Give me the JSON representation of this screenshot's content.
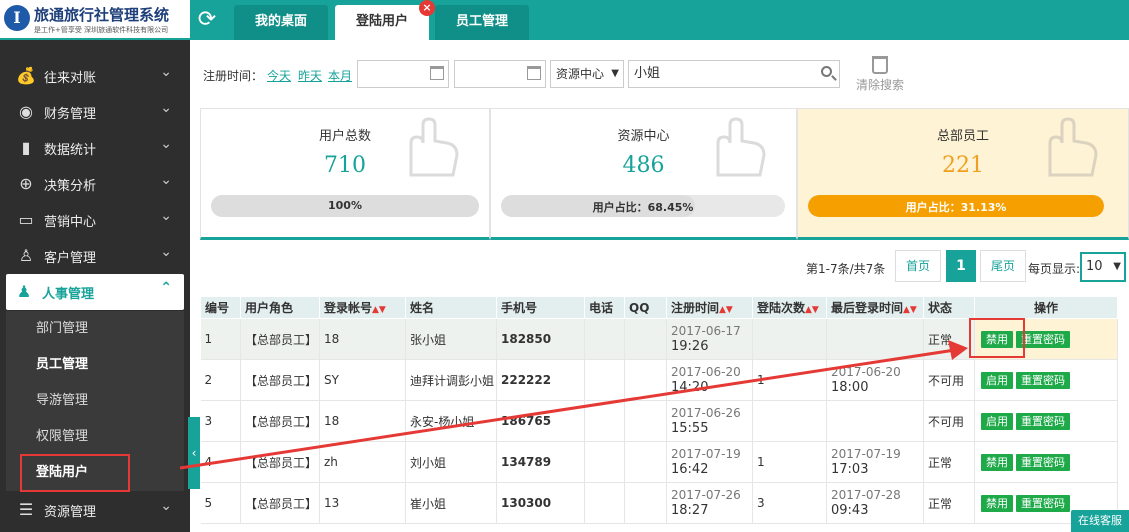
{
  "app": {
    "logo_letter": "I",
    "title": "旅通旅行社管理系统",
    "subtitle": "是工作+管享受  深圳旅通软件科技有限公司"
  },
  "tabs": [
    {
      "label": "我的桌面",
      "active": false
    },
    {
      "label": "登陆用户",
      "active": true,
      "closable": true
    },
    {
      "label": "员工管理",
      "active": false
    }
  ],
  "sidebar": {
    "items": [
      {
        "label": "往来对账",
        "icon": "money-bag-icon"
      },
      {
        "label": "财务管理",
        "icon": "coins-icon"
      },
      {
        "label": "数据统计",
        "icon": "bar-chart-icon"
      },
      {
        "label": "决策分析",
        "icon": "globe-icon"
      },
      {
        "label": "营销中心",
        "icon": "monitor-icon"
      },
      {
        "label": "客户管理",
        "icon": "user-plus-icon"
      },
      {
        "label": "人事管理",
        "icon": "user-icon",
        "open": true
      },
      {
        "label": "资源管理",
        "icon": "list-icon"
      }
    ],
    "subitems": [
      {
        "label": "部门管理",
        "bold": false
      },
      {
        "label": "员工管理",
        "bold": true
      },
      {
        "label": "导游管理",
        "bold": false
      },
      {
        "label": "权限管理",
        "bold": false
      },
      {
        "label": "登陆用户",
        "bold": true,
        "selected": true
      }
    ]
  },
  "filter": {
    "label": "注册时间：",
    "quick": [
      "今天",
      "昨天",
      "本月"
    ],
    "date_from": "",
    "date_to": "",
    "dash": "-",
    "source_select": "资源中心",
    "search_value": "小姐",
    "clear_label": "清除搜索"
  },
  "cards": [
    {
      "title": "用户总数",
      "value": "710",
      "bar_text": "100%",
      "ratio": 1.0,
      "highlight": false
    },
    {
      "title": "资源中心",
      "value": "486",
      "bar_text": "用户占比：68.45%",
      "ratio": 0.6845,
      "highlight": false
    },
    {
      "title": "总部员工",
      "value": "221",
      "bar_text": "用户占比：31.13%",
      "ratio": 0.3113,
      "highlight": true
    }
  ],
  "pager": {
    "info": "第1-7条/共7条",
    "first": "首页",
    "current": "1",
    "last": "尾页",
    "size_label": "每页显示:",
    "size_value": "10"
  },
  "table": {
    "headers": [
      "编号",
      "用户角色",
      "登录帐号",
      "姓名",
      "手机号",
      "电话",
      "QQ",
      "注册时间",
      "登陆次数",
      "最后登录时间",
      "状态",
      "操作"
    ],
    "sortable": [
      false,
      false,
      true,
      false,
      false,
      false,
      false,
      true,
      true,
      true,
      false,
      false
    ],
    "rows": [
      {
        "id": "1",
        "role": "【总部员工】",
        "account": "18",
        "name": "张小姐",
        "phone": "182850",
        "tel": "",
        "qq": "",
        "reg_date": "2017-06-17",
        "reg_time": "19:26",
        "logins": "",
        "last_date": "",
        "last_time": "",
        "status": "正常",
        "btn1": "禁用",
        "btn2": "重置密码"
      },
      {
        "id": "2",
        "role": "【总部员工】",
        "account": "SY",
        "name": "迪拜计调彭小姐",
        "phone": "222222",
        "tel": "",
        "qq": "",
        "reg_date": "2017-06-20",
        "reg_time": "14:20",
        "logins": "1",
        "last_date": "2017-06-20",
        "last_time": "18:00",
        "status": "不可用",
        "btn1": "启用",
        "btn2": "重置密码"
      },
      {
        "id": "3",
        "role": "【总部员工】",
        "account": "18",
        "name": "永安-杨小姐",
        "phone": "186765",
        "tel": "",
        "qq": "",
        "reg_date": "2017-06-26",
        "reg_time": "15:55",
        "logins": "",
        "last_date": "",
        "last_time": "",
        "status": "不可用",
        "btn1": "启用",
        "btn2": "重置密码"
      },
      {
        "id": "4",
        "role": "【总部员工】",
        "account": "zh",
        "name": "刘小姐",
        "phone": "134789",
        "tel": "",
        "qq": "",
        "reg_date": "2017-07-19",
        "reg_time": "16:42",
        "logins": "1",
        "last_date": "2017-07-19",
        "last_time": "17:03",
        "status": "正常",
        "btn1": "禁用",
        "btn2": "重置密码"
      },
      {
        "id": "5",
        "role": "【总部员工】",
        "account": "13",
        "name": "崔小姐",
        "phone": "130300",
        "tel": "",
        "qq": "",
        "reg_date": "2017-07-26",
        "reg_time": "18:27",
        "logins": "3",
        "last_date": "2017-07-28",
        "last_time": "09:43",
        "status": "正常",
        "btn1": "禁用",
        "btn2": "重置密码"
      }
    ]
  },
  "chat_label": "在线客服",
  "colors": {
    "accent": "#18a39a",
    "highlight": "#f5a000",
    "annotation": "#e53935",
    "button": "#1faa4a"
  }
}
